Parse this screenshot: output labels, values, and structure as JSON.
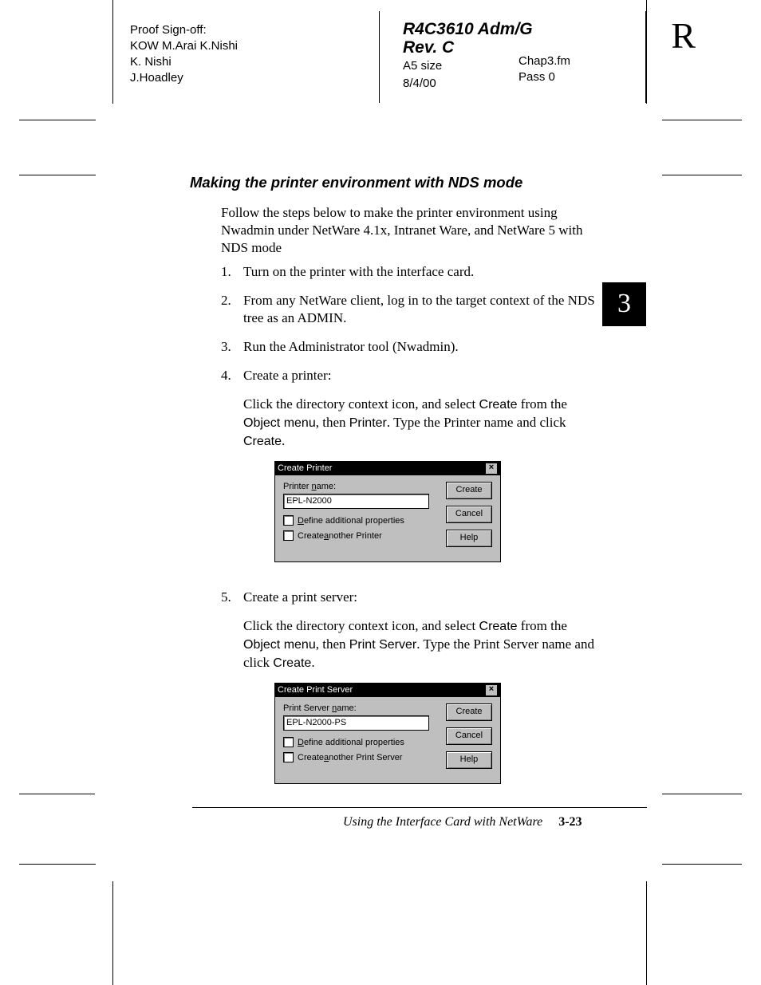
{
  "header": {
    "proof_label": "Proof Sign-off:",
    "proof_names": [
      "KOW M.Arai  K.Nishi",
      "K. Nishi",
      "J.Hoadley"
    ],
    "doc_title1": "R4C3610 Adm/G",
    "doc_title2": "Rev. C",
    "size": "A5 size",
    "date": "8/4/00",
    "file": "Chap3.fm",
    "pass": "Pass 0",
    "big_letter": "R"
  },
  "tab_number": "3",
  "section_heading": "Making the printer environment with NDS mode",
  "intro": "Follow the steps below to make the printer environment using Nwadmin under NetWare 4.1x, Intranet Ware, and NetWare 5 with NDS mode",
  "steps": [
    {
      "n": "1.",
      "text": "Turn on the printer with the interface card."
    },
    {
      "n": "2.",
      "text": "From any NetWare client, log in to the target context of the NDS tree as an ADMIN."
    },
    {
      "n": "3.",
      "text": "Run the Administrator tool (Nwadmin)."
    },
    {
      "n": "4.",
      "text": "Create a printer:",
      "sub_pre": "Click the directory context icon, and select ",
      "sub_ui1": "Create",
      "sub_mid1": " from the ",
      "sub_ui2": "Object menu",
      "sub_mid2": ", then ",
      "sub_ui3": "Printer",
      "sub_mid3": ". Type the Printer name and click ",
      "sub_ui4": "Create",
      "sub_end": "."
    },
    {
      "n": "5.",
      "text": "Create a print server:",
      "sub_pre": "Click the directory context icon, and select ",
      "sub_ui1": "Create",
      "sub_mid1": " from the ",
      "sub_ui2": "Object menu",
      "sub_mid2": ", then ",
      "sub_ui3": "Print Server",
      "sub_mid3": ". Type the Print Server name and click ",
      "sub_ui4": "Create",
      "sub_end": "."
    }
  ],
  "dialog1": {
    "title": "Create Printer",
    "name_label_pre": "Printer ",
    "name_label_ul": "n",
    "name_label_post": "ame:",
    "name_value": "EPL-N2000",
    "chk1_ul": "D",
    "chk1_rest": "efine additional properties",
    "chk2_pre": "Create ",
    "chk2_ul": "a",
    "chk2_rest": "nother Printer",
    "btn_create_ul": "C",
    "btn_create_rest": "reate",
    "btn_cancel": "Cancel",
    "btn_help_ul": "H",
    "btn_help_rest": "elp"
  },
  "dialog2": {
    "title": "Create Print Server",
    "name_label_pre": "Print Server ",
    "name_label_ul": "n",
    "name_label_post": "ame:",
    "name_value": "EPL-N2000-PS",
    "chk1_ul": "D",
    "chk1_rest": "efine additional properties",
    "chk2_pre": "Create ",
    "chk2_ul": "a",
    "chk2_rest": "nother Print Server",
    "btn_create_ul": "C",
    "btn_create_rest": "reate",
    "btn_cancel": "Cancel",
    "btn_help_ul": "H",
    "btn_help_rest": "elp"
  },
  "footer": {
    "chapter": "Using the Interface Card with NetWare",
    "page": "3-23"
  }
}
